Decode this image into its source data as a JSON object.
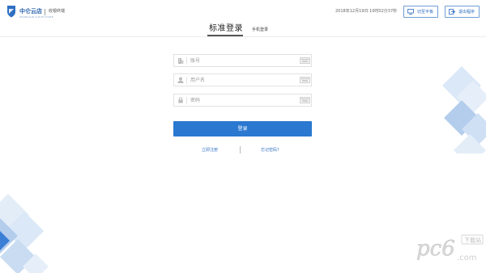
{
  "header": {
    "brand": "中仑云店",
    "brand_sub": "ZHONGLUN CLOUD STORE",
    "subtitle": "收银终端",
    "datetime": "2018年12月19日 10时02分37秒",
    "tablet_button": "切至平板",
    "exit_button": "退出程序",
    "icons": {
      "logo": "shield-logo-icon",
      "tablet": "monitor-icon",
      "exit": "exit-icon"
    }
  },
  "tabs": {
    "standard": "标准登录",
    "mobile": "手机登录",
    "active": "standard"
  },
  "form": {
    "account": {
      "placeholder": "账号",
      "value": "",
      "icon": "building-icon"
    },
    "username": {
      "placeholder": "用户名",
      "value": "",
      "icon": "user-icon"
    },
    "password": {
      "placeholder": "密码",
      "value": "",
      "icon": "lock-icon"
    },
    "keyboard_icon": "keyboard-icon",
    "login_button": "登录",
    "register_link": "立即注册",
    "forgot_link": "忘记密码?"
  },
  "watermark": {
    "logo": "pc6",
    "badge": "下载站",
    "domain": ".com"
  },
  "colors": {
    "accent": "#2a78d0",
    "brand": "#2a63ad",
    "deco_light": "#dbe8f7",
    "deco_mid": "#b4cdec",
    "deco_dark": "#3a7ed6"
  }
}
